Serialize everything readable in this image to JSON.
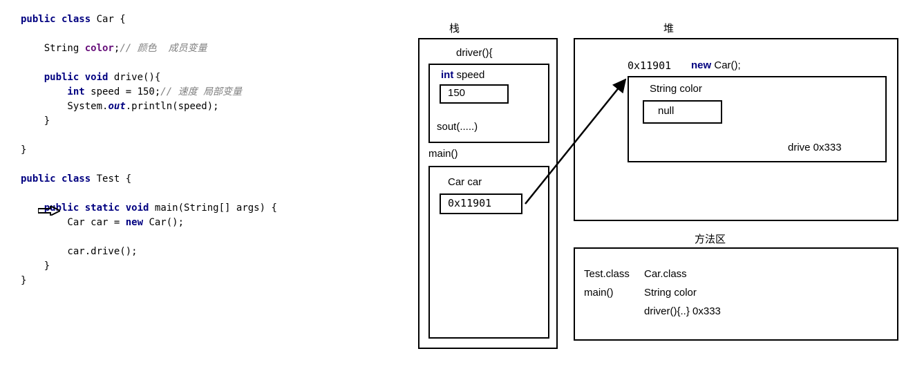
{
  "code": {
    "l1": "public",
    "l1b": " class",
    "l1c": " Car {",
    "l2a": "    String ",
    "l2b": "color",
    "l2c": ";",
    "l2d": "// 颜色  成员变量",
    "l3a": "    public",
    "l3b": " void",
    "l3c": " drive(){",
    "l4a": "        int",
    "l4b": " speed = 150;",
    "l4c": "// 速度 局部变量",
    "l5a": "        System.",
    "l5b": "out",
    "l5c": ".println(speed);",
    "l6": "    }",
    "l7": "}",
    "l8a": "public",
    "l8b": " class",
    "l8c": " Test {",
    "l9a": "    public",
    "l9b": " static",
    "l9c": " void",
    "l9d": " main(String[] args) {",
    "l10a": "        Car car = ",
    "l10b": "new",
    "l10c": " Car();",
    "l11": "        car.drive();",
    "l12": "    }",
    "l13": "}"
  },
  "diagram": {
    "stack_title": "栈",
    "heap_title": "堆",
    "method_title": "方法区",
    "driver_label": "driver(){",
    "int_kw": "int",
    "speed_label": " speed",
    "speed_value": "150",
    "sout_label": "sout(.....)",
    "main_label": "main()",
    "car_var_label": "Car car",
    "car_addr": "0x11901",
    "heap_addr": "0x11901",
    "heap_new_kw": "new",
    "heap_new_rest": " Car();",
    "heap_field": "String color",
    "heap_field_val": "null",
    "heap_method": "drive 0x333",
    "m_test": "Test.class",
    "m_main": "main()",
    "m_car": "Car.class",
    "m_color": "String color",
    "m_driver": "driver(){..}  0x333"
  }
}
